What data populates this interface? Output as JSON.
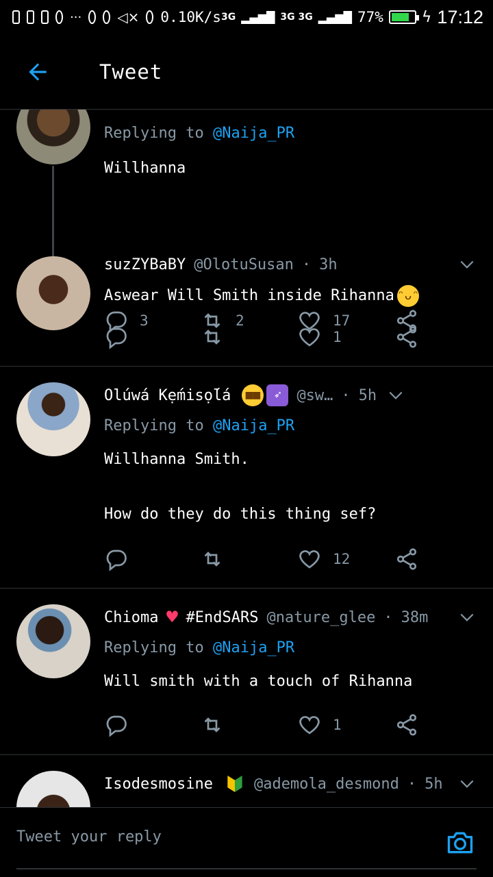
{
  "status_bar": {
    "network_speed": "0.10K/s",
    "battery": "77%",
    "battery_level": 0.77,
    "time": "17:12",
    "signal_labels": [
      "3G",
      "3G 3G"
    ]
  },
  "header": {
    "title": "Tweet",
    "back_icon": "arrow-left-icon",
    "accent": "#1da1f2"
  },
  "tweets": [
    {
      "replying_label": "Replying",
      "replying_to": "to",
      "mention": "@Naija_PR",
      "text": "Willhanna",
      "replies": "3",
      "retweets": "2",
      "likes": "17"
    },
    {
      "name": "suzZYBaBY",
      "handle": "@OlotuSusan",
      "age": "3h",
      "text": "Aswear Will Smith inside Rihanna",
      "emoji": "grinning-face",
      "replies": "",
      "retweets": "",
      "likes": "1"
    },
    {
      "name": "Olúwá Kẹ́misọ́lá",
      "handle": "@sw…",
      "age": "5h",
      "emojis": [
        "sunglasses-face",
        "sagittarius"
      ],
      "replying_label": "Replying",
      "replying_to": "to",
      "mention": "@Naija_PR",
      "text": "Willhanna Smith.\n\nHow do they do this thing sef?",
      "replies": "",
      "retweets": "",
      "likes": "12"
    },
    {
      "name": "Chioma",
      "name_suffix": "#EndSARS",
      "handle": "@nature_glee",
      "age": "38m",
      "emoji": "sparkling-heart",
      "replying_label": "Replying",
      "replying_to": "to",
      "mention": "@Naija_PR",
      "text": "Will smith with a touch of Rihanna",
      "replies": "",
      "retweets": "",
      "likes": "1"
    },
    {
      "name": "Isodesmosine",
      "handle": "@ademola_desmond",
      "age": "5h",
      "emoji": "beginner-badge"
    }
  ],
  "reply_bar": {
    "placeholder": "Tweet your reply",
    "camera_icon": "camera-icon"
  }
}
